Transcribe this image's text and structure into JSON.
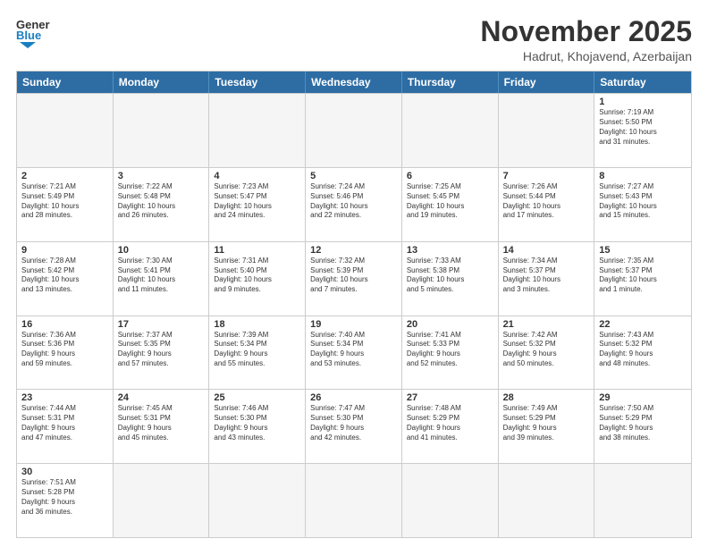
{
  "header": {
    "logo_general": "General",
    "logo_blue": "Blue",
    "month_title": "November 2025",
    "location": "Hadrut, Khojavend, Azerbaijan"
  },
  "weekdays": [
    "Sunday",
    "Monday",
    "Tuesday",
    "Wednesday",
    "Thursday",
    "Friday",
    "Saturday"
  ],
  "rows": [
    [
      {
        "day": "",
        "sun": "",
        "empty": true
      },
      {
        "day": "",
        "sun": "",
        "empty": true
      },
      {
        "day": "",
        "sun": "",
        "empty": true
      },
      {
        "day": "",
        "sun": "",
        "empty": true
      },
      {
        "day": "",
        "sun": "",
        "empty": true
      },
      {
        "day": "",
        "sun": "",
        "empty": true
      },
      {
        "day": "1",
        "sun": "Sunrise: 7:19 AM\nSunset: 5:50 PM\nDaylight: 10 hours\nand 31 minutes."
      }
    ],
    [
      {
        "day": "2",
        "sun": "Sunrise: 7:21 AM\nSunset: 5:49 PM\nDaylight: 10 hours\nand 28 minutes."
      },
      {
        "day": "3",
        "sun": "Sunrise: 7:22 AM\nSunset: 5:48 PM\nDaylight: 10 hours\nand 26 minutes."
      },
      {
        "day": "4",
        "sun": "Sunrise: 7:23 AM\nSunset: 5:47 PM\nDaylight: 10 hours\nand 24 minutes."
      },
      {
        "day": "5",
        "sun": "Sunrise: 7:24 AM\nSunset: 5:46 PM\nDaylight: 10 hours\nand 22 minutes."
      },
      {
        "day": "6",
        "sun": "Sunrise: 7:25 AM\nSunset: 5:45 PM\nDaylight: 10 hours\nand 19 minutes."
      },
      {
        "day": "7",
        "sun": "Sunrise: 7:26 AM\nSunset: 5:44 PM\nDaylight: 10 hours\nand 17 minutes."
      },
      {
        "day": "8",
        "sun": "Sunrise: 7:27 AM\nSunset: 5:43 PM\nDaylight: 10 hours\nand 15 minutes."
      }
    ],
    [
      {
        "day": "9",
        "sun": "Sunrise: 7:28 AM\nSunset: 5:42 PM\nDaylight: 10 hours\nand 13 minutes."
      },
      {
        "day": "10",
        "sun": "Sunrise: 7:30 AM\nSunset: 5:41 PM\nDaylight: 10 hours\nand 11 minutes."
      },
      {
        "day": "11",
        "sun": "Sunrise: 7:31 AM\nSunset: 5:40 PM\nDaylight: 10 hours\nand 9 minutes."
      },
      {
        "day": "12",
        "sun": "Sunrise: 7:32 AM\nSunset: 5:39 PM\nDaylight: 10 hours\nand 7 minutes."
      },
      {
        "day": "13",
        "sun": "Sunrise: 7:33 AM\nSunset: 5:38 PM\nDaylight: 10 hours\nand 5 minutes."
      },
      {
        "day": "14",
        "sun": "Sunrise: 7:34 AM\nSunset: 5:37 PM\nDaylight: 10 hours\nand 3 minutes."
      },
      {
        "day": "15",
        "sun": "Sunrise: 7:35 AM\nSunset: 5:37 PM\nDaylight: 10 hours\nand 1 minute."
      }
    ],
    [
      {
        "day": "16",
        "sun": "Sunrise: 7:36 AM\nSunset: 5:36 PM\nDaylight: 9 hours\nand 59 minutes."
      },
      {
        "day": "17",
        "sun": "Sunrise: 7:37 AM\nSunset: 5:35 PM\nDaylight: 9 hours\nand 57 minutes."
      },
      {
        "day": "18",
        "sun": "Sunrise: 7:39 AM\nSunset: 5:34 PM\nDaylight: 9 hours\nand 55 minutes."
      },
      {
        "day": "19",
        "sun": "Sunrise: 7:40 AM\nSunset: 5:34 PM\nDaylight: 9 hours\nand 53 minutes."
      },
      {
        "day": "20",
        "sun": "Sunrise: 7:41 AM\nSunset: 5:33 PM\nDaylight: 9 hours\nand 52 minutes."
      },
      {
        "day": "21",
        "sun": "Sunrise: 7:42 AM\nSunset: 5:32 PM\nDaylight: 9 hours\nand 50 minutes."
      },
      {
        "day": "22",
        "sun": "Sunrise: 7:43 AM\nSunset: 5:32 PM\nDaylight: 9 hours\nand 48 minutes."
      }
    ],
    [
      {
        "day": "23",
        "sun": "Sunrise: 7:44 AM\nSunset: 5:31 PM\nDaylight: 9 hours\nand 47 minutes."
      },
      {
        "day": "24",
        "sun": "Sunrise: 7:45 AM\nSunset: 5:31 PM\nDaylight: 9 hours\nand 45 minutes."
      },
      {
        "day": "25",
        "sun": "Sunrise: 7:46 AM\nSunset: 5:30 PM\nDaylight: 9 hours\nand 43 minutes."
      },
      {
        "day": "26",
        "sun": "Sunrise: 7:47 AM\nSunset: 5:30 PM\nDaylight: 9 hours\nand 42 minutes."
      },
      {
        "day": "27",
        "sun": "Sunrise: 7:48 AM\nSunset: 5:29 PM\nDaylight: 9 hours\nand 41 minutes."
      },
      {
        "day": "28",
        "sun": "Sunrise: 7:49 AM\nSunset: 5:29 PM\nDaylight: 9 hours\nand 39 minutes."
      },
      {
        "day": "29",
        "sun": "Sunrise: 7:50 AM\nSunset: 5:29 PM\nDaylight: 9 hours\nand 38 minutes."
      }
    ],
    [
      {
        "day": "30",
        "sun": "Sunrise: 7:51 AM\nSunset: 5:28 PM\nDaylight: 9 hours\nand 36 minutes."
      },
      {
        "day": "",
        "sun": "",
        "empty": true
      },
      {
        "day": "",
        "sun": "",
        "empty": true
      },
      {
        "day": "",
        "sun": "",
        "empty": true
      },
      {
        "day": "",
        "sun": "",
        "empty": true
      },
      {
        "day": "",
        "sun": "",
        "empty": true
      },
      {
        "day": "",
        "sun": "",
        "empty": true
      }
    ]
  ]
}
